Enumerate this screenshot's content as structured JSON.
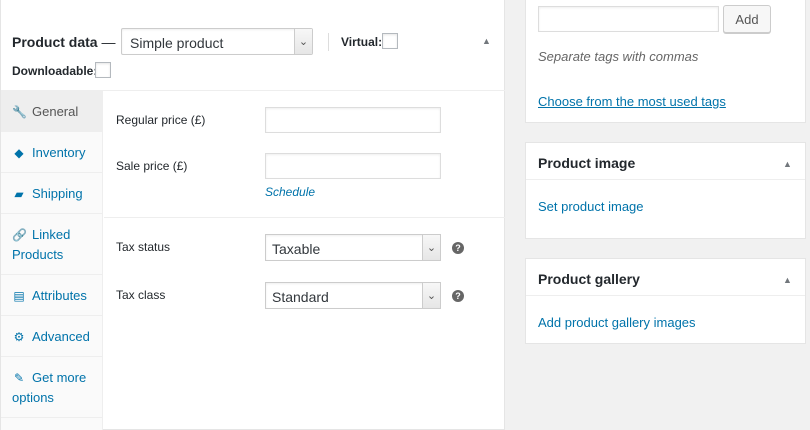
{
  "product_data": {
    "title": "Product data",
    "dash": "—",
    "product_type": "Simple product",
    "virtual_label": "Virtual:",
    "downloadable_label": "Downloadable:",
    "collapse_icon": "triangle-up-icon"
  },
  "tabs": [
    {
      "label": "General",
      "icon": "wrench-icon",
      "glyph": "🔧",
      "active": true
    },
    {
      "label": "Inventory",
      "icon": "tag-icon",
      "glyph": "◆",
      "active": false
    },
    {
      "label": "Shipping",
      "icon": "truck-icon",
      "glyph": "▰",
      "active": false
    },
    {
      "label": "Linked Products",
      "icon": "link-icon",
      "glyph": "🔗",
      "active": false
    },
    {
      "label": "Attributes",
      "icon": "list-icon",
      "glyph": "▤",
      "active": false
    },
    {
      "label": "Advanced",
      "icon": "gear-icon",
      "glyph": "⚙",
      "active": false
    },
    {
      "label": "Get more options",
      "icon": "plug-icon",
      "glyph": "✎",
      "active": false
    }
  ],
  "general": {
    "regular_price_label": "Regular price (£)",
    "regular_price_value": "",
    "sale_price_label": "Sale price (£)",
    "sale_price_value": "",
    "schedule_link": "Schedule",
    "tax_status_label": "Tax status",
    "tax_status_value": "Taxable",
    "tax_class_label": "Tax class",
    "tax_class_value": "Standard",
    "help_glyph": "?"
  },
  "tags": {
    "input_value": "",
    "add_button": "Add",
    "hint": "Separate tags with commas",
    "most_used_link": "Choose from the most used tags"
  },
  "product_image": {
    "title": "Product image",
    "link": "Set product image"
  },
  "product_gallery": {
    "title": "Product gallery",
    "link": "Add product gallery images"
  },
  "colors": {
    "link": "#0073aa",
    "text": "#23282d",
    "background": "#f1f1f1"
  }
}
